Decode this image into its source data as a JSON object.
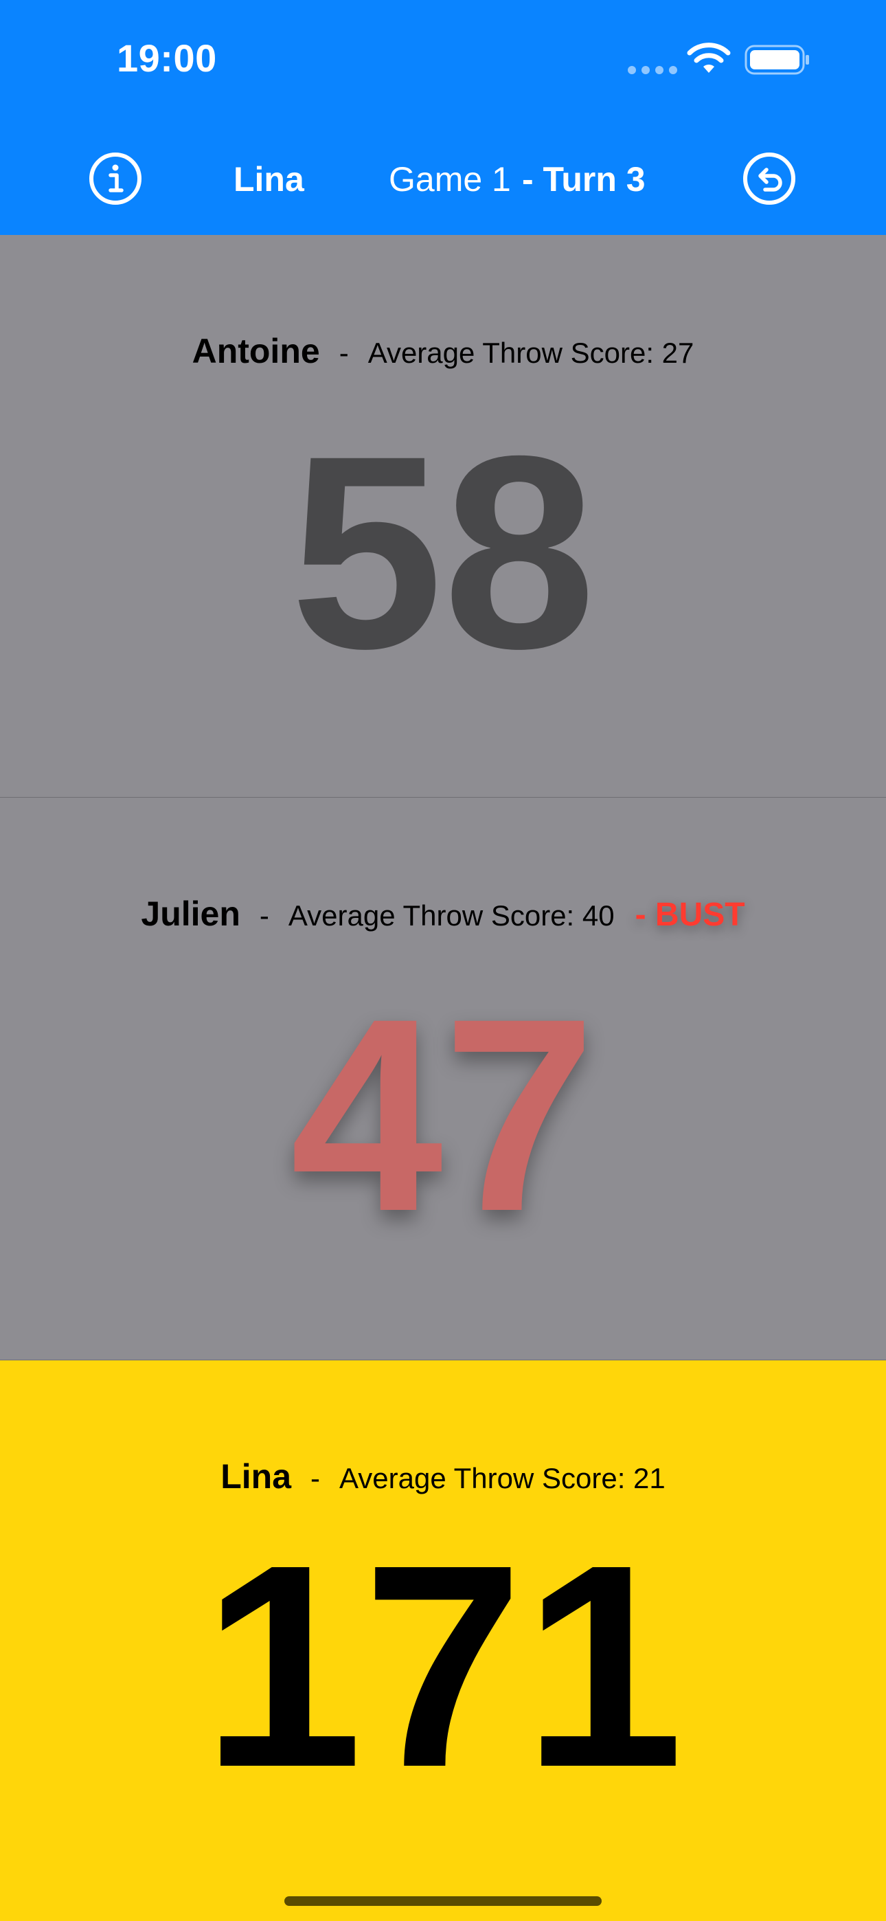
{
  "status_bar": {
    "time": "19:00"
  },
  "nav": {
    "current_player": "Lina",
    "game_label": "Game 1",
    "turn_label": "- Turn 3",
    "info_icon": "info-circle-icon",
    "undo_icon": "undo-arrow-circle-icon"
  },
  "colors": {
    "header_bg": "#0a84ff",
    "inactive_panel_bg": "#8e8d92",
    "active_panel_bg": "#ffd60a",
    "bust_red": "#ff3b30"
  },
  "players": [
    {
      "name": "Antoine",
      "separator": "-",
      "avg_label": "Average Throw Score: 27",
      "score": "58",
      "bust": "",
      "active": false
    },
    {
      "name": "Julien",
      "separator": "-",
      "avg_label": "Average Throw Score: 40",
      "score": "47",
      "bust": "- BUST",
      "active": false
    },
    {
      "name": "Lina",
      "separator": "-",
      "avg_label": "Average Throw Score: 21",
      "score": "171",
      "bust": "",
      "active": true
    }
  ]
}
